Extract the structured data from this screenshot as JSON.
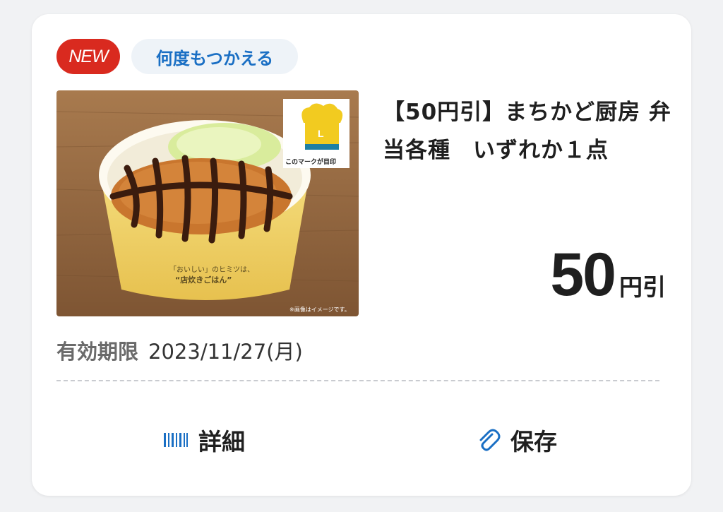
{
  "badges": {
    "new": "NEW",
    "reusable": "何度もつかえる"
  },
  "product": {
    "title": "【50円引】まちかど厨房 弁当各種　いずれか１点",
    "image_logo_caption": "このマークが目印",
    "image_cup_text_1": "「おいしい」のヒミツは、",
    "image_cup_text_2": "“店炊きごはん”",
    "image_note": "※画像はイメージです。"
  },
  "discount": {
    "value": "50",
    "unit": "円引"
  },
  "expiry": {
    "label": "有効期限",
    "value": "2023/11/27(月)"
  },
  "actions": {
    "detail": "詳細",
    "save": "保存"
  },
  "colors": {
    "new_badge": "#d92a1f",
    "accent_blue": "#1a6fc4",
    "card_bg": "#ffffff",
    "page_bg": "#f1f2f4"
  },
  "icons": {
    "detail": "barcode-icon",
    "save": "paperclip-icon"
  }
}
